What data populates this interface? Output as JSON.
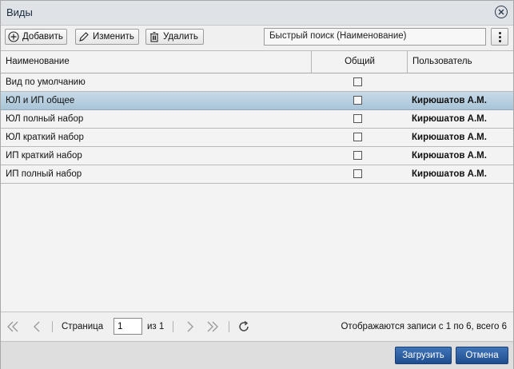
{
  "window": {
    "title": "Виды"
  },
  "toolbar": {
    "add_label": "Добавить",
    "edit_label": "Изменить",
    "delete_label": "Удалить",
    "search_value": "Быстрый поиск (Наименование)"
  },
  "columns": {
    "name": "Наименование",
    "shared": "Общий",
    "user": "Пользователь"
  },
  "rows": [
    {
      "name": "Вид по умолчанию",
      "shared": false,
      "user": "",
      "selected": false
    },
    {
      "name": "ЮЛ и ИП общее",
      "shared": false,
      "user": "Кирюшатов А.М.",
      "selected": true
    },
    {
      "name": "ЮЛ полный набор",
      "shared": false,
      "user": "Кирюшатов А.М.",
      "selected": false
    },
    {
      "name": "ЮЛ краткий набор",
      "shared": false,
      "user": "Кирюшатов А.М.",
      "selected": false
    },
    {
      "name": "ИП краткий набор",
      "shared": false,
      "user": "Кирюшатов А.М.",
      "selected": false
    },
    {
      "name": "ИП полный набор",
      "shared": false,
      "user": "Кирюшатов А.М.",
      "selected": false
    }
  ],
  "pager": {
    "page_label": "Страница",
    "page_value": "1",
    "of_label": "из 1",
    "summary": "Отображаются записи с 1 по 6, всего 6"
  },
  "footer": {
    "load_label": "Загрузить",
    "cancel_label": "Отмена"
  },
  "icons": {
    "close": "close-icon",
    "add": "plus-circle-icon",
    "edit": "pencil-icon",
    "delete": "trash-icon",
    "more": "vertical-ellipsis-icon",
    "first": "double-chevron-left-icon",
    "prev": "chevron-left-icon",
    "next": "chevron-right-icon",
    "last": "double-chevron-right-icon",
    "refresh": "refresh-icon"
  },
  "colors": {
    "primary_button": "#2a5ea3",
    "selected_row": "#b8cfe0"
  }
}
